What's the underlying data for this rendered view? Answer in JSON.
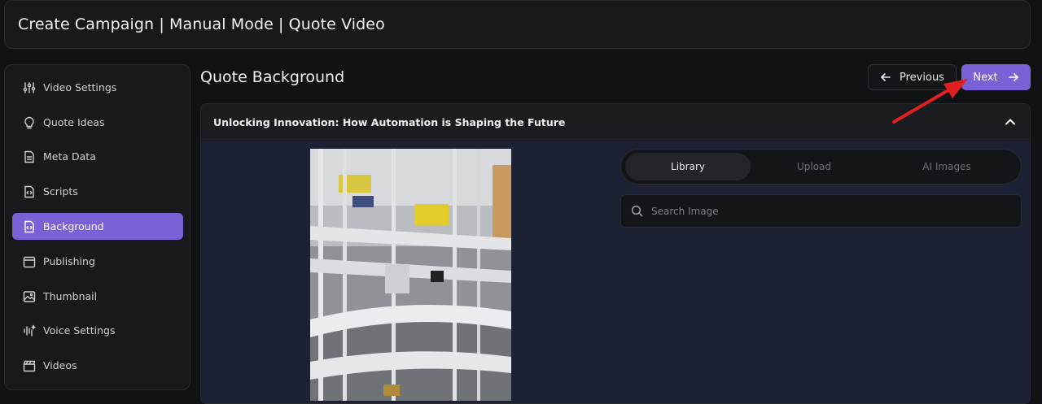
{
  "header": {
    "title": "Create Campaign | Manual Mode | Quote Video"
  },
  "sidebar": {
    "items": [
      {
        "label": "Video Settings",
        "icon": "sliders-icon",
        "active": false
      },
      {
        "label": "Quote Ideas",
        "icon": "lightbulb-icon",
        "active": false
      },
      {
        "label": "Meta Data",
        "icon": "document-icon",
        "active": false
      },
      {
        "label": "Scripts",
        "icon": "code-file-icon",
        "active": false
      },
      {
        "label": "Background",
        "icon": "code-file-icon",
        "active": true
      },
      {
        "label": "Publishing",
        "icon": "calendar-icon",
        "active": false
      },
      {
        "label": "Thumbnail",
        "icon": "image-icon",
        "active": false
      },
      {
        "label": "Voice Settings",
        "icon": "audio-wave-icon",
        "active": false
      },
      {
        "label": "Videos",
        "icon": "clapperboard-icon",
        "active": false
      }
    ]
  },
  "main": {
    "title": "Quote Background",
    "previous_label": "Previous",
    "next_label": "Next",
    "quote": {
      "title": "Unlocking Innovation: How Automation is Shaping the Future"
    },
    "tabs": [
      {
        "label": "Library",
        "active": true
      },
      {
        "label": "Upload",
        "active": false
      },
      {
        "label": "AI Images",
        "active": false
      }
    ],
    "search": {
      "placeholder": "Search Image",
      "value": ""
    },
    "preview_image": "factory-conveyor-photo"
  },
  "colors": {
    "accent": "#7b61d6",
    "background": "#111214",
    "panel": "#18191c",
    "card_body": "#1c2134",
    "annotation_arrow": "#e02020"
  }
}
